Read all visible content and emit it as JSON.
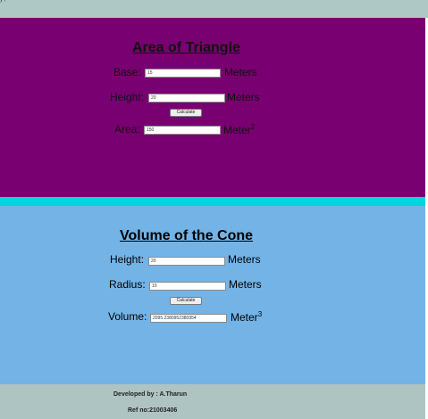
{
  "page": {
    "top_fragment": "y ,",
    "colors": {
      "triangle_bg": "#780070",
      "divider": "#00d6e0",
      "cone_bg": "#73b3e6",
      "footer_bg": "#aec4c2"
    }
  },
  "triangle": {
    "title": "Area of Triangle",
    "base_label": "Base:",
    "base_value": "15",
    "base_unit": "Meters",
    "height_label": "Height:",
    "height_value": "20",
    "height_unit": "Meters",
    "calculate_label": "Calculate",
    "area_label": "Area:",
    "area_value": "150",
    "area_unit": "Meter",
    "area_unit_power": "2"
  },
  "cone": {
    "title": "Volume of the Cone",
    "height_label": "Height:",
    "height_value": "20",
    "height_unit": "Meters",
    "radius_label": "Radius:",
    "radius_value": "10",
    "radius_unit": "Meters",
    "calculate_label": "Calculate",
    "volume_label": "Volume:",
    "volume_value": "2095.2380952380954",
    "volume_unit": "Meter",
    "volume_unit_power": "3"
  },
  "footer": {
    "developer": "Developed by : A.Tharun",
    "ref": "Ref no:21003406"
  }
}
